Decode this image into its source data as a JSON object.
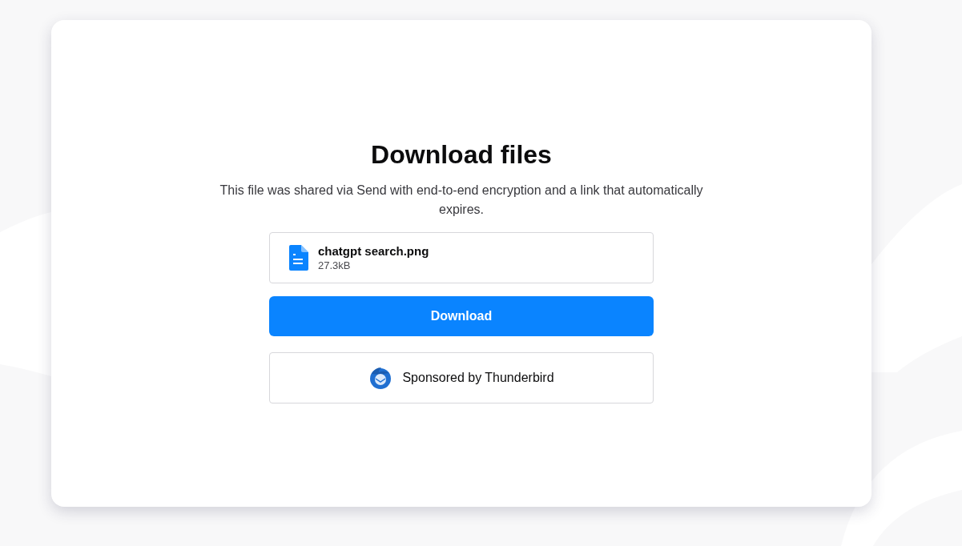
{
  "title": "Download files",
  "description": "This file was shared via Send with end-to-end encryption and a link that automatically expires.",
  "file": {
    "name": "chatgpt search.png",
    "size": "27.3kB"
  },
  "download_button": "Download",
  "sponsor": "Sponsored by Thunderbird"
}
